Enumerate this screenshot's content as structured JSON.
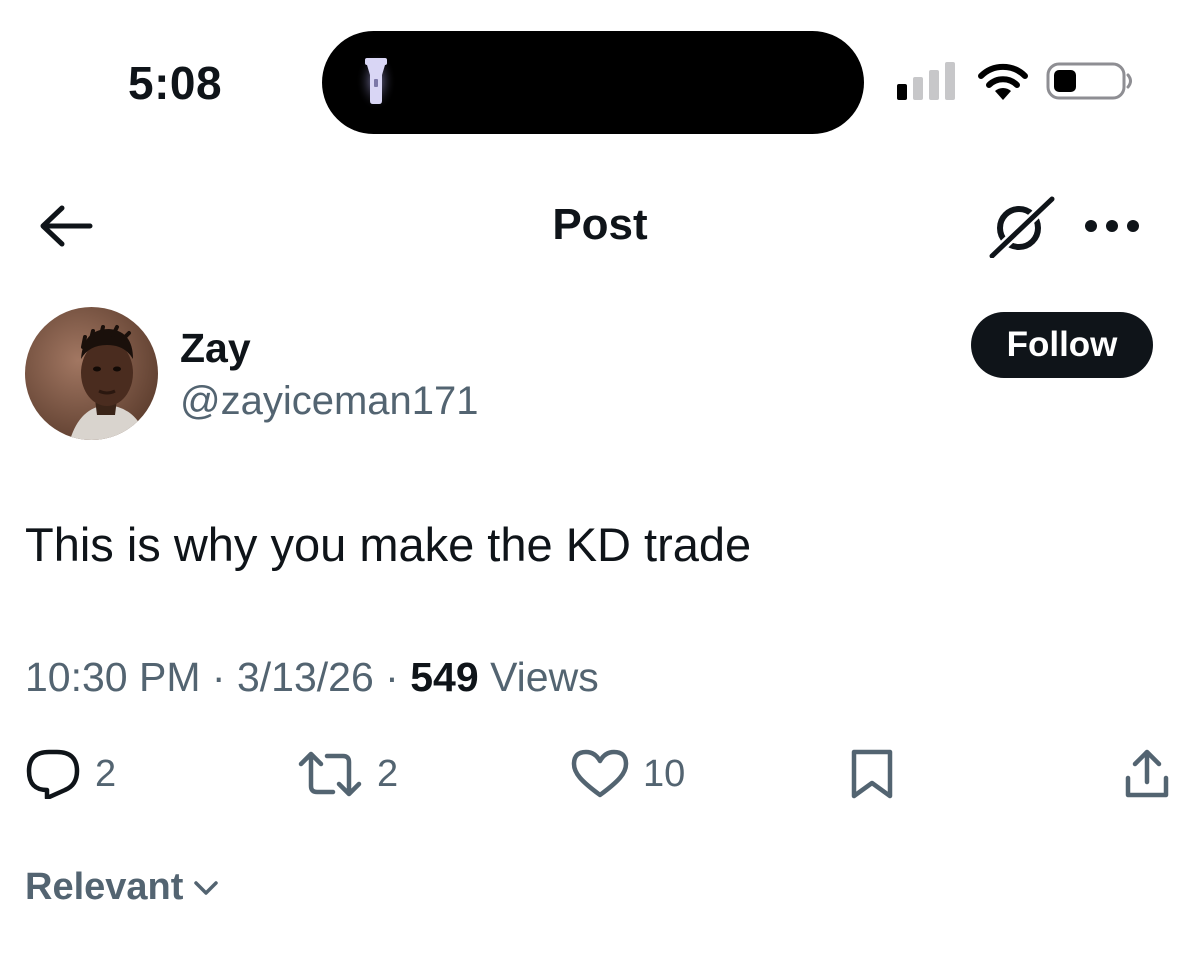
{
  "status_bar": {
    "time": "5:08"
  },
  "header": {
    "title": "Post"
  },
  "author": {
    "name": "Zay",
    "handle": "@zayiceman171",
    "follow_label": "Follow"
  },
  "post": {
    "text": "This is why you make the KD trade",
    "time": "10:30 PM",
    "date": "3/13/26",
    "separator": "·",
    "views_count": "549",
    "views_label": "Views"
  },
  "actions": {
    "replies": "2",
    "reposts": "2",
    "likes": "10"
  },
  "sort": {
    "label": "Relevant"
  },
  "icons": {
    "back": "arrow-left-icon",
    "grok": "grok-icon",
    "more": "ellipsis-icon",
    "reply": "speech-bubble-icon",
    "repost": "repost-icon",
    "like": "heart-icon",
    "bookmark": "bookmark-icon",
    "share": "share-icon",
    "sort": "chevron-down-icon"
  },
  "colors": {
    "text_primary": "#0f1419",
    "text_secondary": "#536471",
    "follow_bg": "#0f1419"
  }
}
